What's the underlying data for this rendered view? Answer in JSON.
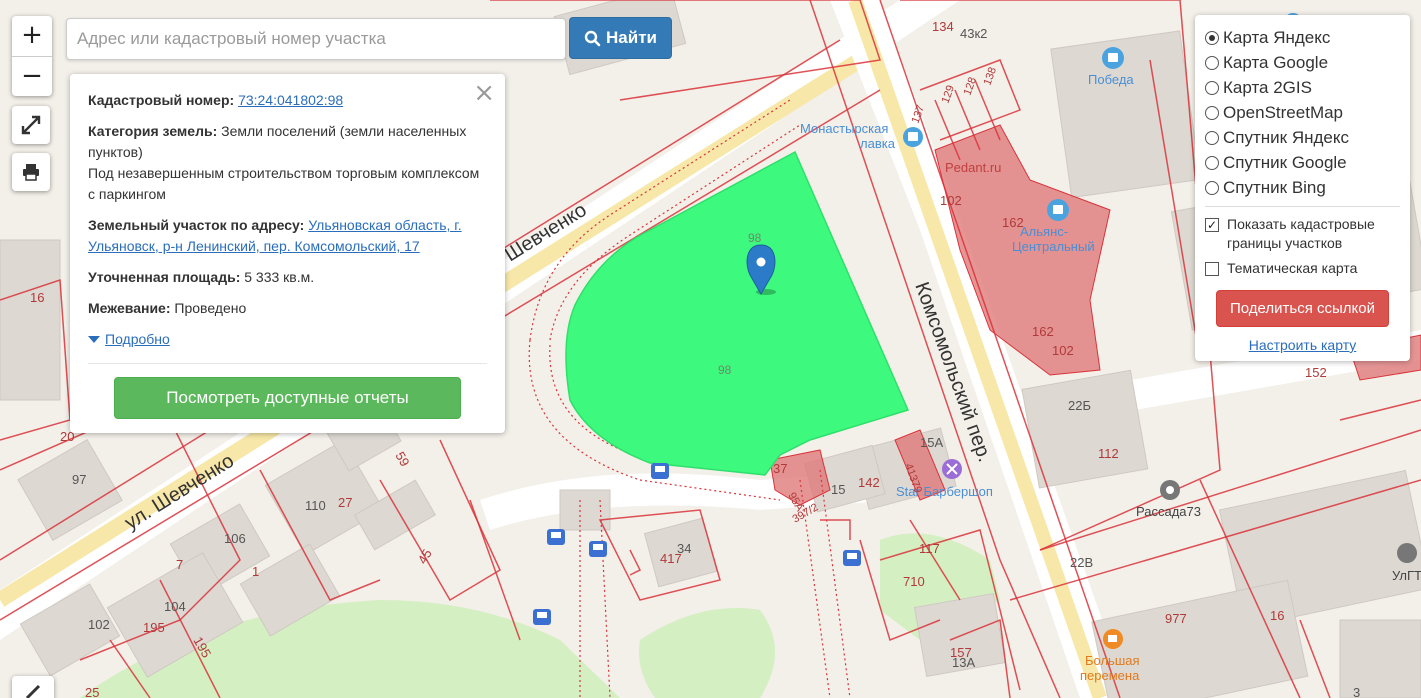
{
  "search": {
    "placeholder": "Адрес или кадастровый номер участка",
    "button_label": "Найти"
  },
  "zoom": {
    "in_label": "+",
    "out_label": "−"
  },
  "info": {
    "cadastral_label": "Кадастровый номер:",
    "cadastral_value": "73:24:041802:98",
    "category_label": "Категория земель:",
    "category_value": "Земли поселений (земли населенных пунктов)",
    "usage_value": "Под незавершенным строительством торговым комплексом с паркингом",
    "address_label": "Земельный участок по адресу:",
    "address_value": "Ульяновская область, г. Ульяновск, р-н Ленинский, пер. Комсомольский, 17",
    "area_label": "Уточненная площадь:",
    "area_value": "5 333 кв.м.",
    "survey_label": "Межевание:",
    "survey_value": "Проведено",
    "more_label": "Подробно",
    "reports_button": "Посмотреть доступные отчеты"
  },
  "layers": {
    "options": [
      {
        "label": "Карта Яндекс",
        "selected": true
      },
      {
        "label": "Карта Google",
        "selected": false
      },
      {
        "label": "Карта 2GIS",
        "selected": false
      },
      {
        "label": "OpenStreetMap",
        "selected": false
      },
      {
        "label": "Спутник Яндекс",
        "selected": false
      },
      {
        "label": "Спутник Google",
        "selected": false
      },
      {
        "label": "Спутник Bing",
        "selected": false
      }
    ],
    "show_cadastral_label": "Показать кадастровые границы участков",
    "show_cadastral_checked": true,
    "thematic_label": "Тематическая карта",
    "thematic_checked": false,
    "share_button": "Поделиться ссылкой",
    "configure_link": "Настроить карту"
  },
  "map": {
    "streets": [
      "Шевченко",
      "ул. Шевченко",
      "Комсомольский пер."
    ],
    "pois": [
      "Победа",
      "Монастырская лавка",
      "Pedant.ru",
      "Альянс-Центральный",
      "Рассада73",
      "Большая перемена",
      "Star Барбершоп",
      "УлГТ"
    ],
    "parcel_labels": [
      "98",
      "98"
    ],
    "house_numbers": [
      "134",
      "43к2",
      "129",
      "128",
      "138",
      "137",
      "102",
      "162",
      "162",
      "102",
      "152",
      "22Б",
      "112",
      "15А",
      "142",
      "15",
      "37",
      "95А",
      "397/2",
      "41379",
      "117",
      "710",
      "22В",
      "977",
      "16",
      "157",
      "13А",
      "3",
      "110",
      "27",
      "59",
      "97",
      "106",
      "104",
      "102",
      "195",
      "195",
      "45",
      "1",
      "7",
      "34",
      "417",
      "16",
      "20",
      "25"
    ],
    "colors": {
      "selected_parcel": "#3dfa7e",
      "parcel_border": "#d9333a",
      "building_highlight": "#e07a7a",
      "park": "#d4efc2"
    }
  }
}
